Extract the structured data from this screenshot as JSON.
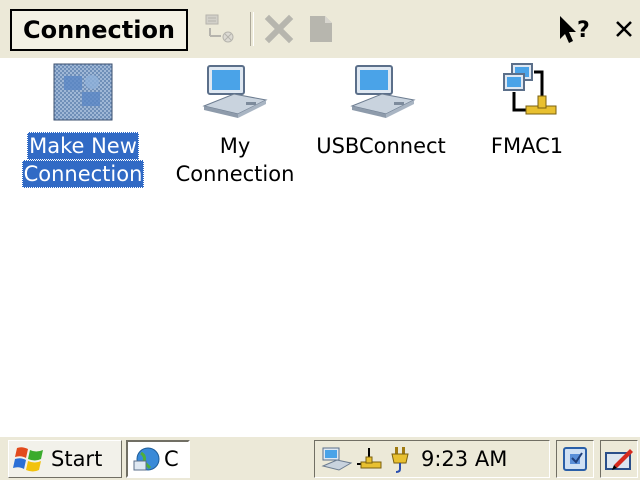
{
  "cmdbar": {
    "menu_title": "Connection",
    "icons": {
      "properties": "connection-properties-icon",
      "delete": "delete-icon",
      "rename": "rename-icon",
      "help": "help-icon",
      "close": "close-icon"
    }
  },
  "items": [
    {
      "label_lines": [
        "Make New",
        "Connection"
      ],
      "icon": "make-new-connection-icon",
      "selected": true
    },
    {
      "label_lines": [
        "My",
        "Connection"
      ],
      "icon": "dialup-connection-icon",
      "selected": false
    },
    {
      "label_lines": [
        "USBConnect",
        ""
      ],
      "icon": "usb-connection-icon",
      "selected": false
    },
    {
      "label_lines": [
        "FMAC1",
        ""
      ],
      "icon": "network-connection-icon",
      "selected": false
    }
  ],
  "taskbar": {
    "start_label": "Start",
    "task_label": "C",
    "clock": "9:23 AM",
    "tray_icons": [
      "connection-tray-icon",
      "network-tray-icon",
      "power-plug-icon"
    ]
  },
  "colors": {
    "selection": "#316ac5",
    "bar": "#ece9d8"
  }
}
